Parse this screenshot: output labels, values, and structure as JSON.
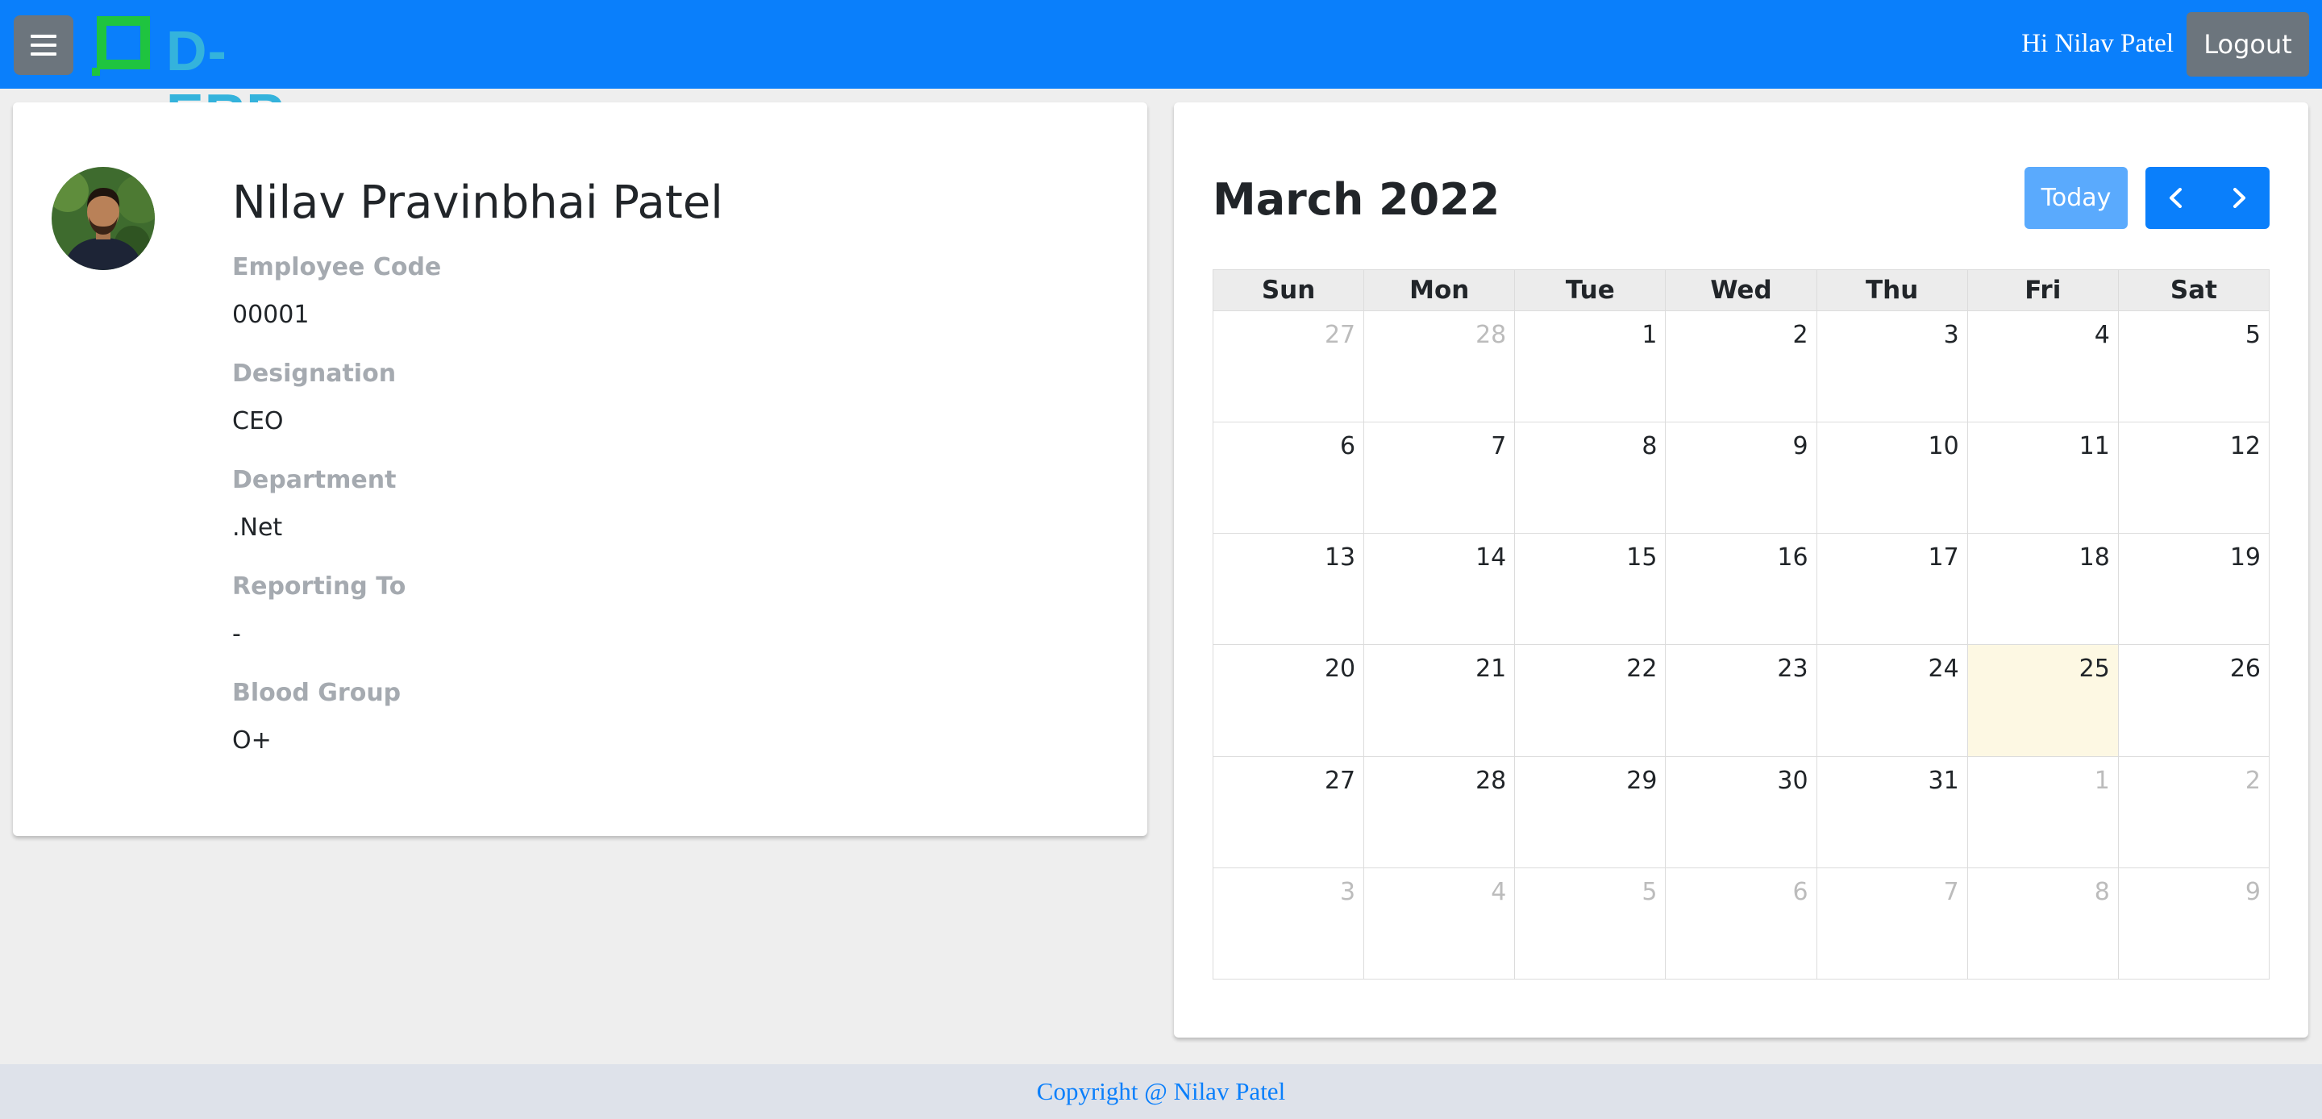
{
  "header": {
    "logo_text": "D-ERP",
    "greeting": "Hi Nilav Patel",
    "logout_label": "Logout"
  },
  "profile": {
    "name": "Nilav Pravinbhai Patel",
    "fields": [
      {
        "label": "Employee Code",
        "value": "00001"
      },
      {
        "label": "Designation",
        "value": "CEO"
      },
      {
        "label": "Department",
        "value": ".Net"
      },
      {
        "label": "Reporting To",
        "value": "-"
      },
      {
        "label": "Blood Group",
        "value": "O+"
      }
    ]
  },
  "calendar": {
    "title": "March 2022",
    "today_label": "Today",
    "weekdays": [
      "Sun",
      "Mon",
      "Tue",
      "Wed",
      "Thu",
      "Fri",
      "Sat"
    ],
    "weeks": [
      [
        "27",
        "28",
        "1",
        "2",
        "3",
        "4",
        "5"
      ],
      [
        "6",
        "7",
        "8",
        "9",
        "10",
        "11",
        "12"
      ],
      [
        "13",
        "14",
        "15",
        "16",
        "17",
        "18",
        "19"
      ],
      [
        "20",
        "21",
        "22",
        "23",
        "24",
        "25",
        "26"
      ],
      [
        "27",
        "28",
        "29",
        "30",
        "31",
        "1",
        "2"
      ],
      [
        "3",
        "4",
        "5",
        "6",
        "7",
        "8",
        "9"
      ]
    ],
    "today_day": "25",
    "today_highlight_color": "#fdf8e3"
  },
  "footer": {
    "copyright": "Copyright @ Nilav Patel"
  },
  "colors": {
    "navbar": "#0a7ffb",
    "secondary_button": "#6c757d",
    "today_button": "#5aaafd",
    "label_text": "#a5aab0",
    "footer_bg": "#dee2ea"
  },
  "icons": {
    "menu": "hamburger-icon",
    "prev": "chevron-left-icon",
    "next": "chevron-right-icon"
  }
}
